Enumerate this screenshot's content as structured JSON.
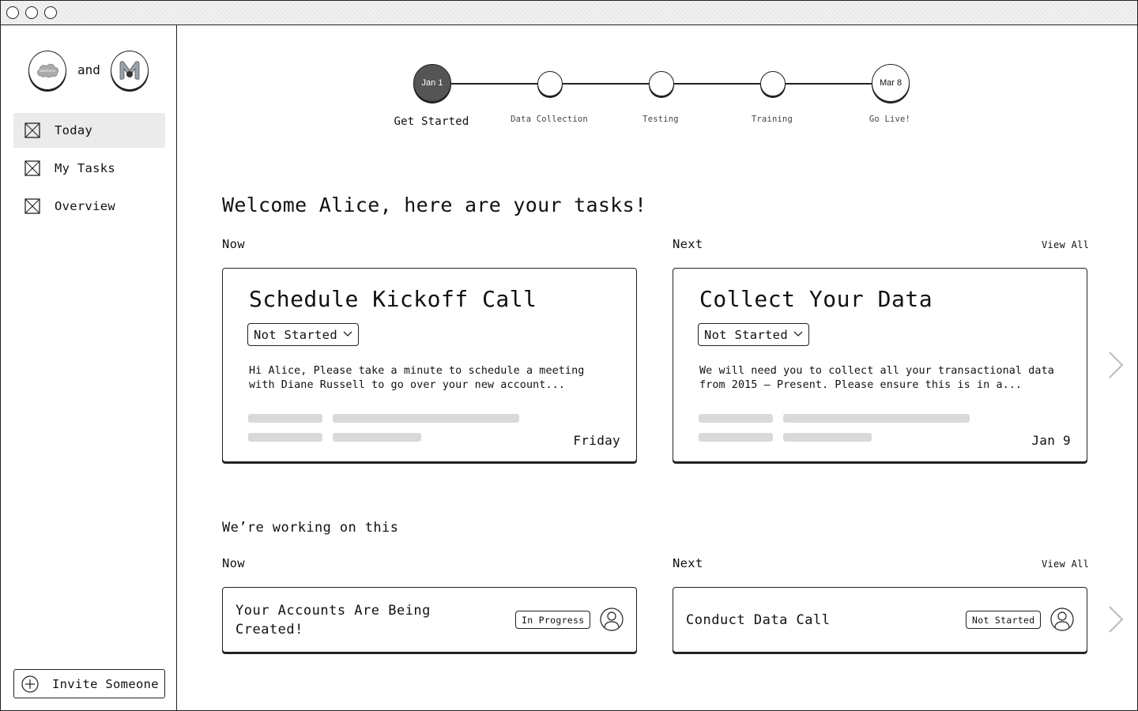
{
  "window": {
    "controls": [
      "close",
      "minimize",
      "maximize"
    ]
  },
  "sidebar": {
    "logos": {
      "left": "salesforce-logo",
      "connector": "and",
      "right": "partner-logo"
    },
    "items": [
      {
        "label": "Today",
        "icon": "placeholder-image-icon",
        "active": true
      },
      {
        "label": "My Tasks",
        "icon": "placeholder-image-icon",
        "active": false
      },
      {
        "label": "Overview",
        "icon": "placeholder-image-icon",
        "active": false
      }
    ],
    "invite_label": "Invite Someone"
  },
  "stepper": {
    "steps": [
      {
        "node_text": "Jan 1",
        "label": "Get Started",
        "state": "done"
      },
      {
        "node_text": "",
        "label": "Data Collection",
        "state": "pending"
      },
      {
        "node_text": "",
        "label": "Testing",
        "state": "pending"
      },
      {
        "node_text": "",
        "label": "Training",
        "state": "pending"
      },
      {
        "node_text": "Mar 8",
        "label": "Go Live!",
        "state": "pending"
      }
    ]
  },
  "welcome": "Welcome Alice, here are your tasks!",
  "tasks": {
    "now_label": "Now",
    "next_label": "Next",
    "view_all": "View All",
    "cards": [
      {
        "title": "Schedule Kickoff Call",
        "status": "Not Started",
        "description": "Hi Alice, Please take a minute to schedule a meeting with Diane Russell to go over your new account...",
        "date": "Friday"
      },
      {
        "title": "Collect Your Data",
        "status": "Not Started",
        "description": "We will need you to collect all your transactional data from 2015 – Present. Please ensure this is in a...",
        "date": "Jan 9"
      }
    ]
  },
  "working": {
    "heading": "We’re working on this",
    "now_label": "Now",
    "next_label": "Next",
    "view_all": "View All",
    "cards": [
      {
        "title": "Your Accounts Are Being Created!",
        "status": "In Progress"
      },
      {
        "title": "Conduct Data Call",
        "status": "Not Started"
      }
    ]
  },
  "colors": {
    "ink": "#222222",
    "active_nav": "#ebebeb",
    "skeleton": "#d9d9d9",
    "done_step": "#555555"
  }
}
